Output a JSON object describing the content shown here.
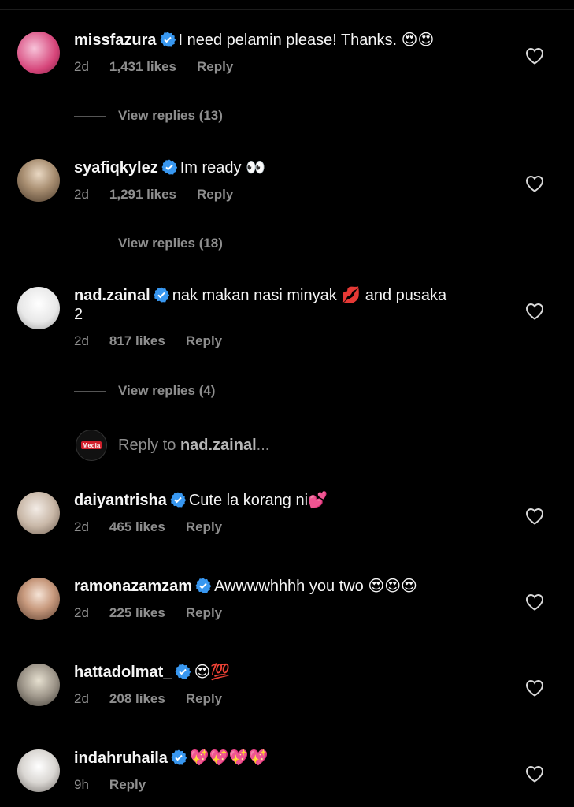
{
  "comments": [
    {
      "username": "missfazura",
      "text": "I need pelamin please! Thanks. 😍😍",
      "time": "2d",
      "likes": "1,431 likes",
      "reply": "Reply",
      "view_replies": "View replies (13)"
    },
    {
      "username": "syafiqkylez",
      "text": "Im ready 👀",
      "time": "2d",
      "likes": "1,291 likes",
      "reply": "Reply",
      "view_replies": "View replies (18)"
    },
    {
      "username": "nad.zainal",
      "text": "nak makan nasi minyak 💋 and pusaka",
      "text2": "2",
      "time": "2d",
      "likes": "817 likes",
      "reply": "Reply",
      "view_replies": "View replies (4)"
    },
    {
      "username": "daiyantrisha",
      "text": "Cute la korang ni💕",
      "time": "2d",
      "likes": "465 likes",
      "reply": "Reply"
    },
    {
      "username": "ramonazamzam",
      "text": "Awwwwhhhh you two 😍😍😍",
      "time": "2d",
      "likes": "225 likes",
      "reply": "Reply"
    },
    {
      "username": "hattadolmat_",
      "text": "😍💯",
      "time": "2d",
      "likes": "208 likes",
      "reply": "Reply"
    },
    {
      "username": "indahruhaila",
      "text": "💖💖💖💖",
      "time": "9h",
      "reply": "Reply"
    }
  ],
  "reply_to": {
    "prefix": "Reply to ",
    "user": "nad.zainal",
    "suffix": "...",
    "avatar_text": "Media"
  },
  "colors": {
    "verified": "#3897f0",
    "muted": "#8e8e8e"
  }
}
